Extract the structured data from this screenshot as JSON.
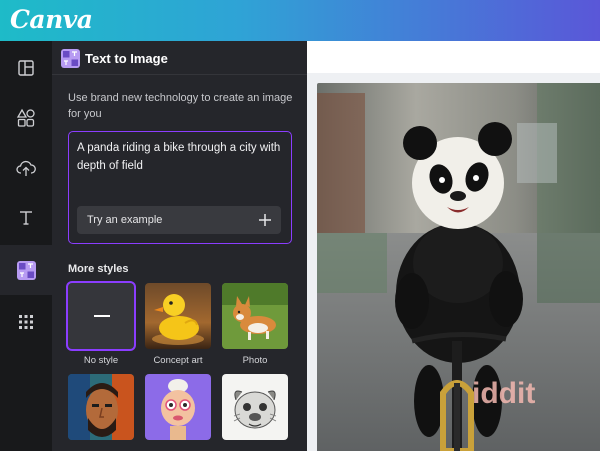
{
  "app": {
    "logo": "Canva"
  },
  "panel": {
    "title": "Text to Image",
    "description": "Use brand new technology to create an image for you",
    "prompt": "A panda riding a bike through a city with depth of field",
    "try_example": "Try an example",
    "styles_heading": "More styles",
    "styles": [
      {
        "label": "No style",
        "selected": true
      },
      {
        "label": "Concept art",
        "selected": false
      },
      {
        "label": "Photo",
        "selected": false
      },
      {
        "label": "",
        "selected": false
      },
      {
        "label": "",
        "selected": false
      },
      {
        "label": "",
        "selected": false
      }
    ]
  },
  "rail": [
    {
      "icon": "layout-icon"
    },
    {
      "icon": "elements-icon"
    },
    {
      "icon": "upload-icon"
    },
    {
      "icon": "text-icon"
    },
    {
      "icon": "text-to-image-app-icon",
      "active": true
    },
    {
      "icon": "apps-grid-icon"
    }
  ],
  "canvas": {
    "watermark": "iddit"
  },
  "colors": {
    "accent": "#8b3dff",
    "panel_bg": "#25262b",
    "rail_bg": "#18191b"
  }
}
